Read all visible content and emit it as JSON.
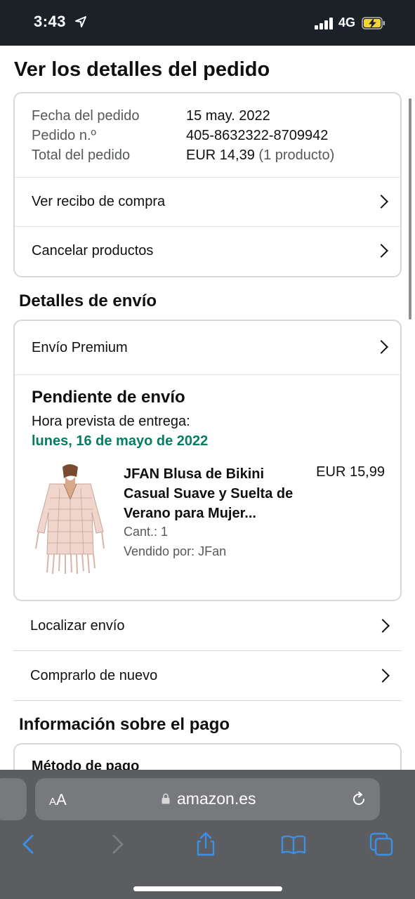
{
  "status": {
    "time": "3:43",
    "network": "4G"
  },
  "page": {
    "title": "Ver los detalles del pedido",
    "summary": {
      "date_label": "Fecha del pedido",
      "date_value": "15 may. 2022",
      "order_label": "Pedido n.º",
      "order_value": "405-8632322-8709942",
      "total_label": "Total del pedido",
      "total_value": "EUR 14,39",
      "total_count": "(1 producto)",
      "receipt_link": "Ver recibo de compra",
      "cancel_link": "Cancelar productos"
    },
    "shipping": {
      "section_title": "Detalles de envío",
      "method": "Envío Premium",
      "status": "Pendiente de envío",
      "eta_label": "Hora prevista de entrega:",
      "eta_date": "lunes, 16 de mayo de 2022",
      "product": {
        "title": "JFAN Blusa de Bikini Casual Suave y Suelta de Verano para Mujer...",
        "price": "EUR 15,99",
        "qty": "Cant.: 1",
        "seller": "Vendido por: JFan"
      },
      "track_link": "Localizar envío",
      "rebuy_link": "Comprarlo de nuevo"
    },
    "payment": {
      "section_title": "Información sobre el pago",
      "method_label": "Método de pago"
    }
  },
  "browser": {
    "aa_label_small": "A",
    "aa_label_big": "A",
    "url": "amazon.es",
    "icons": [
      "back-icon",
      "forward-icon",
      "share-icon",
      "bookmarks-icon",
      "tabs-icon"
    ],
    "accent": "#3c8fe8"
  },
  "colors": {
    "eta_green": "#067d62",
    "status_bar": "#1c2128",
    "browser_bar": "#5b5d61"
  }
}
